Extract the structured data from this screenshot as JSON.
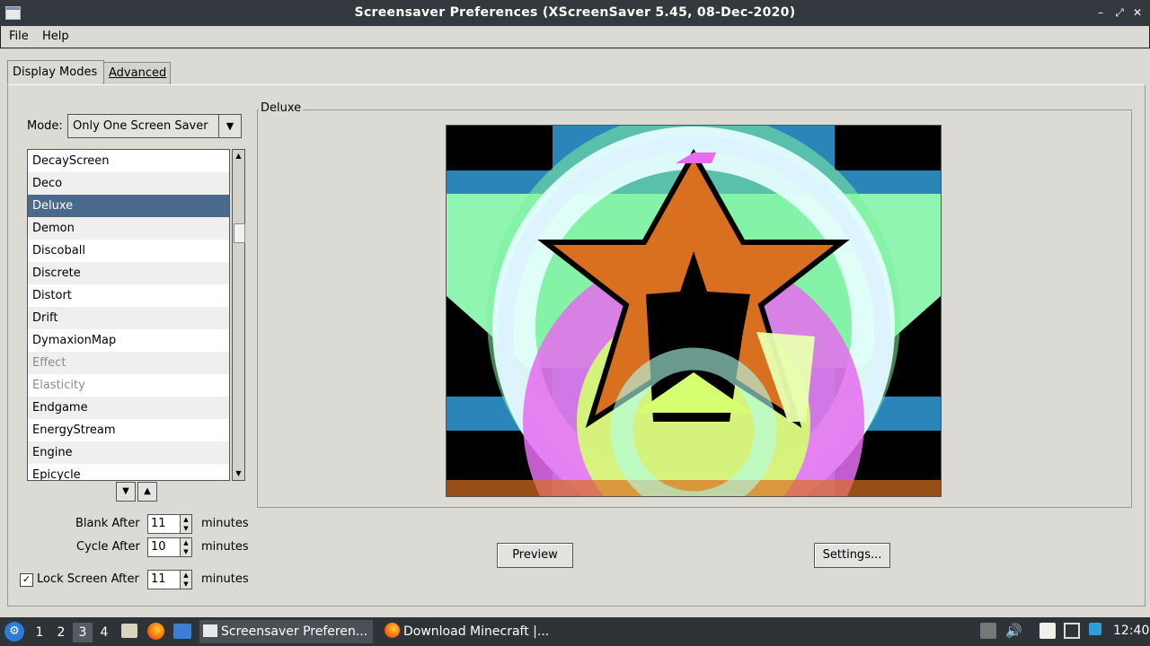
{
  "window": {
    "title": "Screensaver Preferences  (XScreenSaver 5.45, 08-Dec-2020)"
  },
  "menu": {
    "file": "File",
    "help": "Help"
  },
  "tabs": [
    "Display Modes",
    "Advanced"
  ],
  "mode": {
    "label": "Mode:",
    "value": "Only One Screen Saver"
  },
  "savers": [
    {
      "name": "DecayScreen",
      "state": "normal"
    },
    {
      "name": "Deco",
      "state": "normal"
    },
    {
      "name": "Deluxe",
      "state": "selected"
    },
    {
      "name": "Demon",
      "state": "normal"
    },
    {
      "name": "Discoball",
      "state": "normal"
    },
    {
      "name": "Discrete",
      "state": "normal"
    },
    {
      "name": "Distort",
      "state": "normal"
    },
    {
      "name": "Drift",
      "state": "normal"
    },
    {
      "name": "DymaxionMap",
      "state": "normal"
    },
    {
      "name": "Effect",
      "state": "disabled"
    },
    {
      "name": "Elasticity",
      "state": "disabled"
    },
    {
      "name": "Endgame",
      "state": "normal"
    },
    {
      "name": "EnergyStream",
      "state": "normal"
    },
    {
      "name": "Engine",
      "state": "normal"
    },
    {
      "name": "Epicycle",
      "state": "normal"
    }
  ],
  "timing": {
    "blank_label": "Blank After",
    "blank_value": "11",
    "cycle_label": "Cycle After",
    "cycle_value": "10",
    "lock_label": "Lock Screen After",
    "lock_value": "11",
    "lock_checked": true,
    "unit": "minutes"
  },
  "preview_frame": {
    "title": "Deluxe"
  },
  "buttons": {
    "preview": "Preview",
    "settings": "Settings..."
  },
  "taskbar": {
    "workspaces": [
      "1",
      "2",
      "3",
      "4"
    ],
    "active_workspace": "3",
    "tasks": [
      "Screensaver Preferen...",
      "Download Minecraft |..."
    ],
    "clock": "12:40"
  },
  "colors": {
    "titlebar": "#33393f",
    "selection": "#4a6a8c",
    "taskbar": "#2e3338"
  }
}
